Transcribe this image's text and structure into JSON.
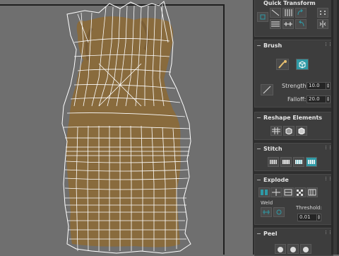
{
  "panel": {
    "quick_transform_title": "Quick Transform",
    "brush": {
      "title": "Brush",
      "strength_label": "Strength:",
      "strength_value": "10.0",
      "falloff_label": "Falloff:",
      "falloff_value": "20.0"
    },
    "reshape_title": "Reshape Elements",
    "stitch_title": "Stitch",
    "explode": {
      "title": "Explode",
      "weld_label": "Weld",
      "threshold_label": "Threshold:",
      "threshold_value": "0.01"
    },
    "peel_title": "Peel"
  },
  "colors": {
    "accent_teal": "#2e9aa6",
    "uv_texture": "#8a6a3a",
    "wire": "#ffffff",
    "viewport_bg": "#6f6f6f"
  },
  "icons": [
    "uv-wireframe",
    "straighten-icon",
    "paint-brush-icon",
    "cube-icon",
    "slash-icon",
    "grid-icon",
    "stitch-icon",
    "explode-icon",
    "weld-icon",
    "peel-icon"
  ]
}
